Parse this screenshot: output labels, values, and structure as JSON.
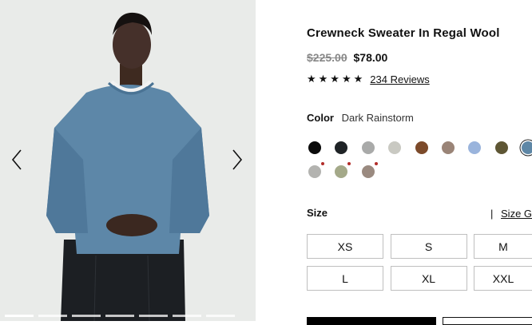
{
  "gallery": {
    "prev_icon": "chevron-left-icon",
    "next_icon": "chevron-right-icon",
    "slide_count": 7,
    "active_slide": 1
  },
  "product": {
    "title": "Crewneck Sweater In Regal Wool",
    "original_price": "$225.00",
    "sale_price": "$78.00",
    "stars": "★★★★★",
    "rating": 5,
    "reviews_label": "234 Reviews"
  },
  "color": {
    "label": "Color",
    "selected_name": "Dark Rainstorm",
    "swatches": [
      {
        "hex": "#0b0b0b",
        "flag": false
      },
      {
        "hex": "#1f2326",
        "flag": false
      },
      {
        "hex": "#a9aaa9",
        "flag": false
      },
      {
        "hex": "#c9c9c2",
        "flag": false
      },
      {
        "hex": "#7c4a2a",
        "flag": false
      },
      {
        "hex": "#9a8477",
        "flag": false
      },
      {
        "hex": "#9ab4dc",
        "flag": false
      },
      {
        "hex": "#5e5634",
        "flag": false
      },
      {
        "hex": "#5e87a6",
        "flag": false,
        "selected": true
      },
      {
        "hex": "#b3b3b0",
        "flag": true
      },
      {
        "hex": "#a4a989",
        "flag": true
      },
      {
        "hex": "#9a8a80",
        "flag": true
      }
    ]
  },
  "size": {
    "label": "Size",
    "separator": "|",
    "guide_label": "Size Gu",
    "options": [
      "XS",
      "S",
      "M",
      "L",
      "XL",
      "XXL"
    ]
  },
  "colors": {
    "sale_strike": "#888888",
    "background": "#e9ebe9",
    "sweater": "#5d87a8"
  }
}
